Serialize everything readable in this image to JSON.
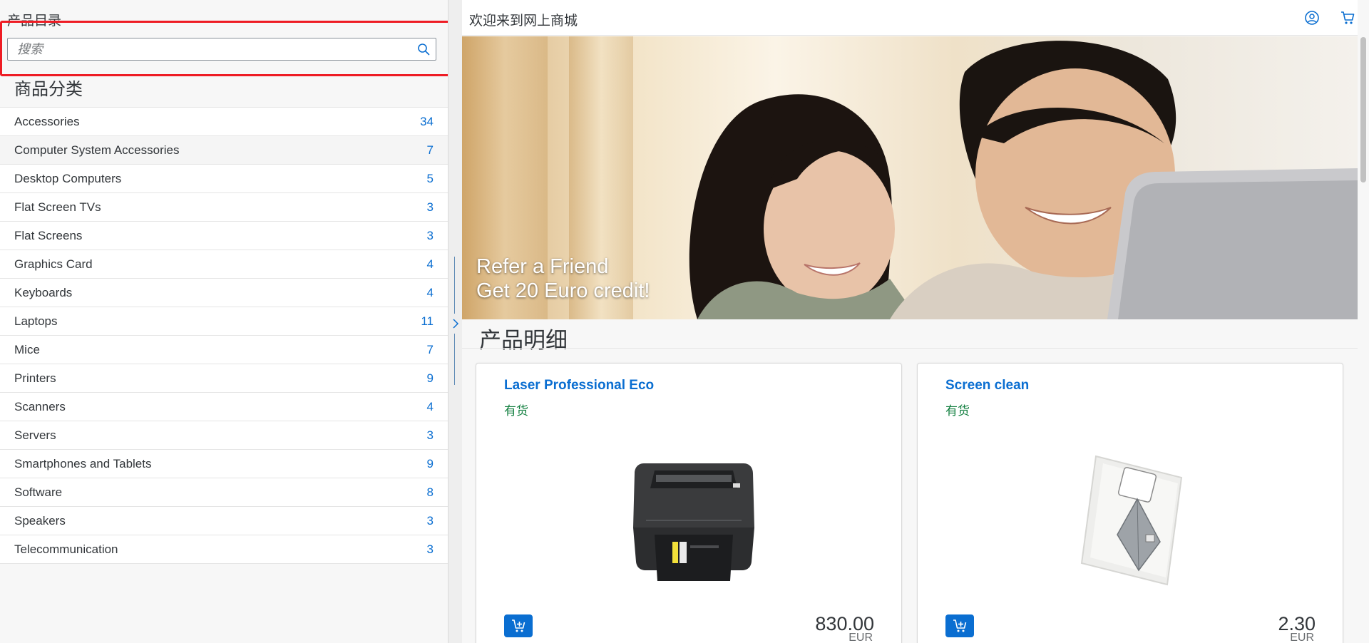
{
  "catalog": {
    "title": "产品目录",
    "search": {
      "placeholder": "搜索",
      "value": ""
    },
    "category_heading": "商品分类",
    "categories": [
      {
        "name": "Accessories",
        "count": "34"
      },
      {
        "name": "Computer System Accessories",
        "count": "7"
      },
      {
        "name": "Desktop Computers",
        "count": "5"
      },
      {
        "name": "Flat Screen TVs",
        "count": "3"
      },
      {
        "name": "Flat Screens",
        "count": "3"
      },
      {
        "name": "Graphics Card",
        "count": "4"
      },
      {
        "name": "Keyboards",
        "count": "4"
      },
      {
        "name": "Laptops",
        "count": "11"
      },
      {
        "name": "Mice",
        "count": "7"
      },
      {
        "name": "Printers",
        "count": "9"
      },
      {
        "name": "Scanners",
        "count": "4"
      },
      {
        "name": "Servers",
        "count": "3"
      },
      {
        "name": "Smartphones and Tablets",
        "count": "9"
      },
      {
        "name": "Software",
        "count": "8"
      },
      {
        "name": "Speakers",
        "count": "3"
      },
      {
        "name": "Telecommunication",
        "count": "3"
      }
    ]
  },
  "header": {
    "title": "欢迎来到网上商城",
    "icons": [
      "account-icon",
      "cart-icon"
    ]
  },
  "banner": {
    "line1": "Refer a Friend",
    "line2": "Get 20 Euro credit!"
  },
  "products_section": {
    "title": "产品明细",
    "products": [
      {
        "name": "Laser Professional Eco",
        "status": "有货",
        "price": "830.00",
        "currency": "EUR",
        "image": "printer"
      },
      {
        "name": "Screen clean",
        "status": "有货",
        "price": "2.30",
        "currency": "EUR",
        "image": "screen-cleaner"
      }
    ]
  },
  "colors": {
    "accent": "#0a6ed1",
    "success": "#107e3e",
    "highlight": "#ee1c24"
  }
}
